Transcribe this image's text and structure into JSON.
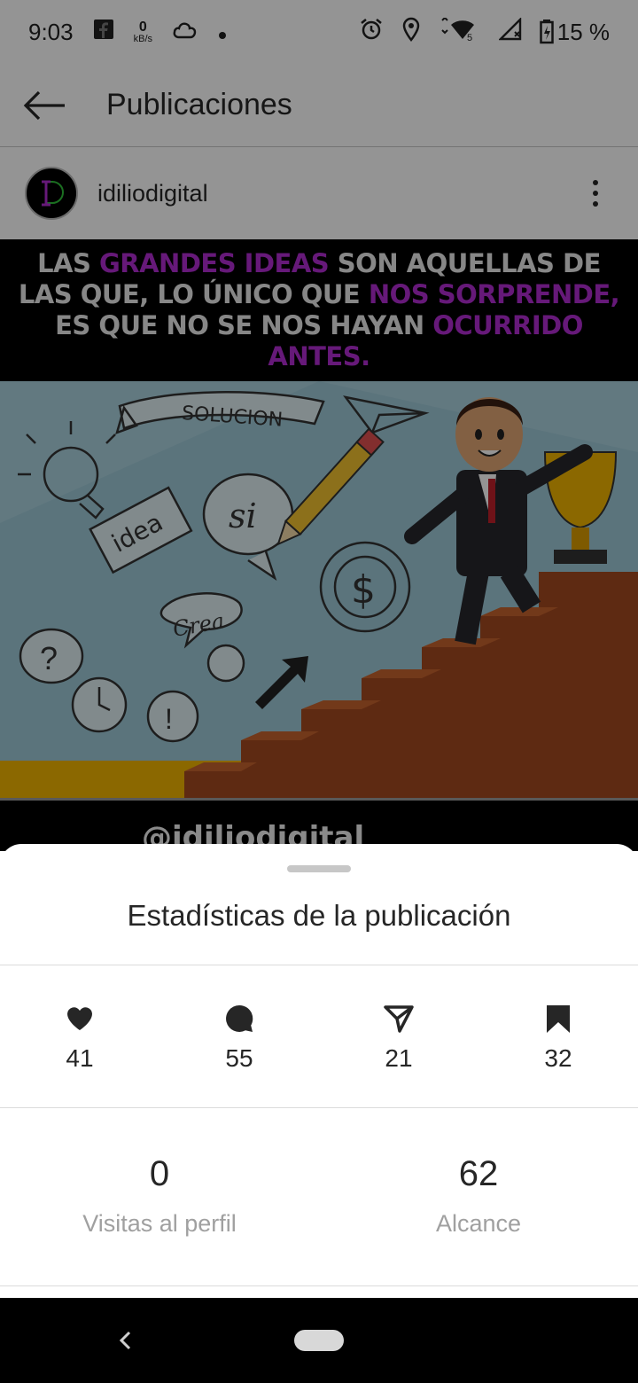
{
  "status_bar": {
    "time": "9:03",
    "net_speed_value": "0",
    "net_speed_unit": "kB/s",
    "battery": "15 %"
  },
  "header": {
    "title": "Publicaciones"
  },
  "post": {
    "author": "idiliodigital",
    "quote": {
      "p1": "LAS ",
      "h1": "GRANDES IDEAS",
      "p2": " SON AQUELLAS DE LAS QUE, LO ÚNICO QUE ",
      "h2": "NOS SORPRENDE,",
      "p3": " ES QUE NO SE NOS HAYAN ",
      "h3": "OCURRIDO ANTES."
    },
    "doodle_labels": {
      "banner": "SOLUCION",
      "idea": "idea",
      "si": "si",
      "crea": "Crea"
    },
    "footer_handle": "@idiliodigital"
  },
  "sheet": {
    "title": "Estadísticas de la publicación",
    "metrics": [
      {
        "icon": "heart-icon",
        "value": "41"
      },
      {
        "icon": "comment-icon",
        "value": "55"
      },
      {
        "icon": "send-icon",
        "value": "21"
      },
      {
        "icon": "bookmark-icon",
        "value": "32"
      }
    ],
    "profile_visits": {
      "value": "0",
      "label": "Visitas al perfil"
    },
    "reach": {
      "value": "62",
      "label": "Alcance"
    }
  },
  "colors": {
    "accent_purple": "#b02bd0",
    "text": "#262626",
    "muted": "#a0a0a0"
  }
}
